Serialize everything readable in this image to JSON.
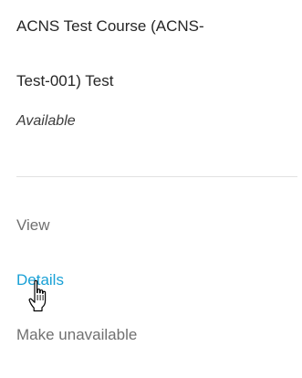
{
  "course": {
    "title_line1": "ACNS Test Course (ACNS-",
    "title_line2": "Test-001) Test",
    "status": "Available"
  },
  "menu": {
    "items": [
      {
        "label": "View",
        "state": "default"
      },
      {
        "label": "Details",
        "state": "hover"
      },
      {
        "label": "Make unavailable",
        "state": "default"
      }
    ]
  },
  "colors": {
    "text": "#262626",
    "muted": "#707070",
    "accent": "#1aa1d6",
    "divider": "#e1e1e1"
  },
  "icons": {
    "cursor": "hand-pointer-icon"
  }
}
